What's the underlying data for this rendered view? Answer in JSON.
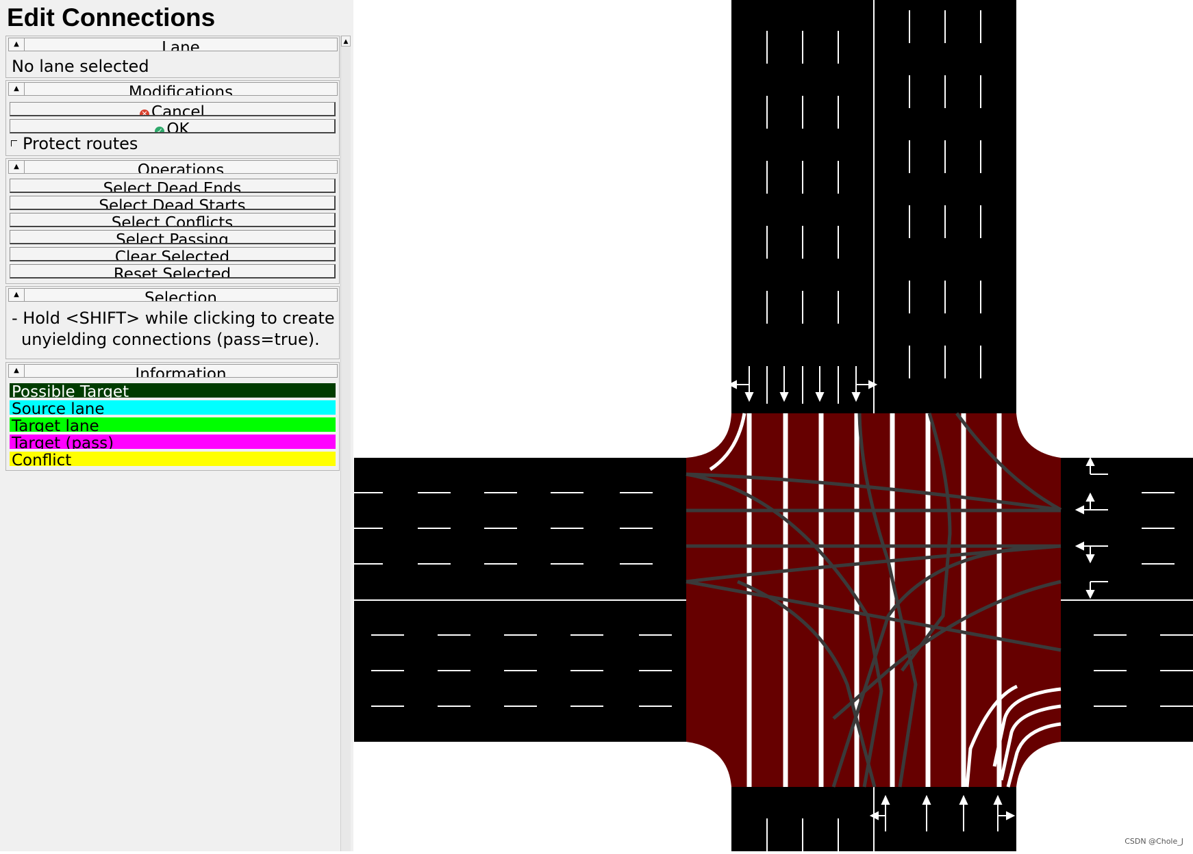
{
  "panel": {
    "title": "Edit Connections",
    "lane": {
      "header": "Lane",
      "status": "No lane selected"
    },
    "modifications": {
      "header": "Modifications",
      "cancel_label": "Cancel",
      "ok_label": "OK",
      "protect_routes_label": "Protect routes",
      "protect_routes_checked": false
    },
    "operations": {
      "header": "Operations",
      "buttons": [
        "Select Dead Ends",
        "Select Dead Starts",
        "Select Conflicts",
        "Select Passing",
        "Clear Selected",
        "Reset Selected"
      ]
    },
    "selection": {
      "header": "Selection",
      "hint_line1": "- Hold <SHIFT> while clicking to create",
      "hint_line2": "unyielding connections (pass=true)."
    },
    "information": {
      "header": "Information",
      "legend": [
        {
          "label": "Possible Target",
          "color": "#003c00",
          "text_color": "#ffffff"
        },
        {
          "label": "Source lane",
          "color": "#00ffff",
          "text_color": "#000000"
        },
        {
          "label": "Target lane",
          "color": "#00ff00",
          "text_color": "#000000"
        },
        {
          "label": "Target (pass)",
          "color": "#ff00ff",
          "text_color": "#000000"
        },
        {
          "label": "Conflict",
          "color": "#ffff00",
          "text_color": "#000000"
        }
      ]
    }
  },
  "canvas": {
    "road_color": "#000000",
    "junction_color": "#660000",
    "connection_color": "#3a3a3a",
    "marking_color": "#ffffff"
  },
  "watermark": "CSDN @Chole_J"
}
